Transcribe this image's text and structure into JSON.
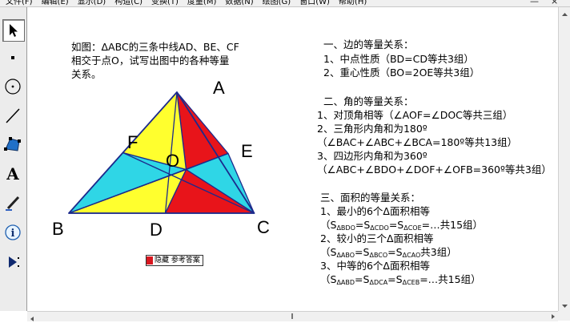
{
  "menu": {
    "items": [
      "文件(F)",
      "编辑(E)",
      "显示(D)",
      "构造(C)",
      "变换(T)",
      "度量(M)",
      "数据(N)",
      "绘图(G)",
      "窗口(W)",
      "帮助(H)"
    ]
  },
  "toolbox": {
    "tools": [
      "arrow-select-icon",
      "point-icon",
      "compass-icon",
      "straightedge-icon",
      "polygon-icon",
      "text-icon",
      "marker-icon",
      "info-icon",
      "custom-tool-icon"
    ]
  },
  "problem": {
    "line1": "如图：ΔABC的三条中线AD、BE、CF",
    "line2": "相交于点O，试写出图中的各种等量",
    "line3": "关系。"
  },
  "figure": {
    "labels": {
      "A": "A",
      "B": "B",
      "C": "C",
      "D": "D",
      "E": "E",
      "F": "F",
      "O": "O"
    },
    "colors": {
      "red": "#e8141a",
      "cyan": "#2fd6e6",
      "yellow": "#ffff2e",
      "stroke": "#1c2a8c"
    }
  },
  "answers": {
    "sec1_title": "一、边的等量关系：",
    "sec1_item1": "1、中点性质（BD=CD等共3组）",
    "sec1_item2": "2、重心性质（BO=2OE等共3组）",
    "sec2_title": "二、角的等量关系：",
    "sec2_item1": "1、对顶角相等（∠AOF=∠DOC等共三组）",
    "sec2_item2": "2、三角形内角和为180º",
    "sec2_item2b": "（∠BAC+∠ABC+∠BCA=180º等共13组）",
    "sec2_item3": "3、四边形内角和为360º",
    "sec2_item3b": "（∠ABC+∠BDO+∠DOF+∠OFB=360º等共3组）",
    "sec3_title": "三、面积的等量关系：",
    "sec3_item1": "1、最小的6个Δ面积相等",
    "sec3_item1b": {
      "s": "S",
      "t": "ΔBDO",
      "eq1": "=S",
      "t2": "ΔCDO",
      "eq2": "=S",
      "t3": "ΔCOE",
      "tail": "=…共15组）"
    },
    "sec3_item2": "2、较小的三个Δ面积相等",
    "sec3_item2b": {
      "s": "S",
      "t": "ΔABO",
      "eq1": "=S",
      "t2": "ΔBCO",
      "eq2": "=S",
      "t3": "ΔCAO",
      "tail": "共3组）"
    },
    "sec3_item3": "3、中等的6个Δ面积相等",
    "sec3_item3b": {
      "s": "S",
      "t": "ΔABD",
      "eq1": "=S",
      "t2": "ΔDCA",
      "eq2": "=S",
      "t3": "ΔCEB",
      "tail": "=…共15组）"
    }
  },
  "hide_button": {
    "label": "隐藏 参考答案"
  }
}
